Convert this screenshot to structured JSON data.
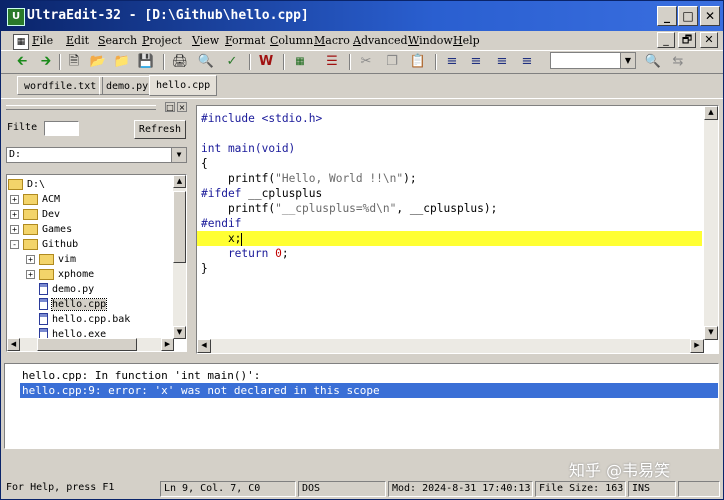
{
  "window": {
    "title": "UltraEdit-32 - [D:\\Github\\hello.cpp]",
    "app_icon": "ultraedit-app-icon",
    "controls": [
      "_",
      "□",
      "✕"
    ],
    "mdi_controls": [
      "_",
      "🗗",
      "✕"
    ]
  },
  "menu": {
    "items": [
      "File",
      "Edit",
      "Search",
      "Project",
      "View",
      "Format",
      "Column",
      "Macro",
      "Advanced",
      "Window",
      "Help"
    ]
  },
  "toolbar": {
    "icons": [
      "arrow-back-icon",
      "arrow-forward-icon",
      "new-file-icon",
      "open-folder-icon",
      "open-file-icon",
      "save-icon",
      "print-icon",
      "print-preview-icon",
      "spell-check-icon",
      "word-wrap-icon",
      "hex-mode-icon",
      "column-mode-icon",
      "cut-icon",
      "copy-icon",
      "paste-icon",
      "align-left-icon",
      "align-center-icon",
      "align-right-icon",
      "justify-icon",
      "find-icon",
      "replace-icon"
    ],
    "search_value": ""
  },
  "tabs": [
    {
      "label": "wordfile.txt",
      "active": false
    },
    {
      "label": "demo.py",
      "active": false
    },
    {
      "label": "hello.cpp",
      "active": true
    }
  ],
  "file_panel": {
    "filter_label": "Filte",
    "filter_value": "",
    "refresh_label": "Refresh",
    "drive": "D:",
    "tree": [
      {
        "label": "D:\\",
        "depth": 0,
        "kind": "folder",
        "expander": ""
      },
      {
        "label": "ACM",
        "depth": 1,
        "kind": "folder",
        "expander": "+"
      },
      {
        "label": "Dev",
        "depth": 1,
        "kind": "folder",
        "expander": "+"
      },
      {
        "label": "Games",
        "depth": 1,
        "kind": "folder",
        "expander": "+"
      },
      {
        "label": "Github",
        "depth": 1,
        "kind": "folder",
        "expander": "-"
      },
      {
        "label": "vim",
        "depth": 2,
        "kind": "folder",
        "expander": "+"
      },
      {
        "label": "xphome",
        "depth": 2,
        "kind": "folder",
        "expander": "+"
      },
      {
        "label": "demo.py",
        "depth": 2,
        "kind": "file",
        "expander": ""
      },
      {
        "label": "hello.cpp",
        "depth": 2,
        "kind": "file",
        "expander": "",
        "selected": true
      },
      {
        "label": "hello.cpp.bak",
        "depth": 2,
        "kind": "file",
        "expander": ""
      },
      {
        "label": "hello.exe",
        "depth": 2,
        "kind": "file",
        "expander": ""
      }
    ]
  },
  "editor": {
    "highlighted_line": 9,
    "lines": [
      [
        {
          "t": "#include <stdio.h>",
          "c": "kw"
        }
      ],
      [],
      [
        {
          "t": "int main(void)",
          "c": "kw"
        }
      ],
      [
        {
          "t": "{",
          "c": ""
        }
      ],
      [
        {
          "t": "    printf(",
          "c": ""
        },
        {
          "t": "\"Hello, World !!\\n\"",
          "c": "str"
        },
        {
          "t": ");",
          "c": ""
        }
      ],
      [
        {
          "t": "#ifdef",
          "c": "kw"
        },
        {
          "t": " __cplusplus",
          "c": ""
        }
      ],
      [
        {
          "t": "    printf(",
          "c": ""
        },
        {
          "t": "\"__cplusplus=%d\\n\"",
          "c": "str"
        },
        {
          "t": ", __cplusplus);",
          "c": ""
        }
      ],
      [
        {
          "t": "#endif",
          "c": "kw"
        }
      ],
      [
        {
          "t": "    x;",
          "c": ""
        }
      ],
      [
        {
          "t": "    return ",
          "c": "kw"
        },
        {
          "t": "0",
          "c": "num"
        },
        {
          "t": ";",
          "c": ""
        }
      ],
      [
        {
          "t": "}",
          "c": ""
        }
      ]
    ]
  },
  "output": {
    "lines": [
      {
        "text": "hello.cpp: In function 'int main()':",
        "selected": false
      },
      {
        "text": "hello.cpp:9: error: 'x' was not declared in this scope",
        "selected": true
      }
    ]
  },
  "watermark": "知乎 @韦易笑",
  "status": {
    "help": "For Help, press F1",
    "position": "Ln 9, Col. 7, C0",
    "line_ending": "DOS",
    "modified": "Mod: 2024-8-31 17:40:13",
    "file_size": "File Size: 163",
    "mode": "INS"
  },
  "colors": {
    "titlebar": "#0a246a",
    "highlight_line": "#ffff33",
    "selection": "#3a6fd6",
    "keyword": "#1a1a9a"
  }
}
